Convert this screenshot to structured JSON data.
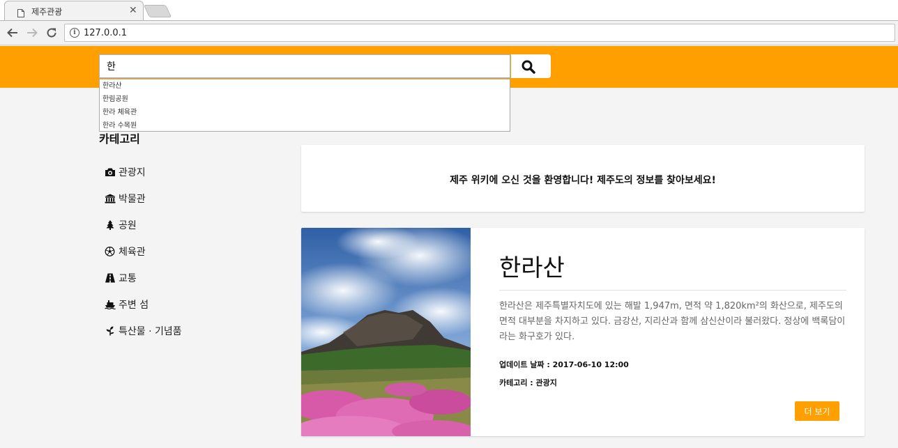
{
  "browser": {
    "tab_title": "제주관광",
    "close_glyph": "✕",
    "url": "127.0.0.1"
  },
  "search": {
    "value": "한",
    "icon": "search-icon"
  },
  "autocomplete": {
    "items": [
      "한라산",
      "한림공원",
      "한라 체육관",
      "한라 수목원"
    ]
  },
  "sidebar": {
    "title": "카테고리",
    "items": [
      {
        "label": "관광지",
        "icon": "camera-icon"
      },
      {
        "label": "박물관",
        "icon": "museum-icon"
      },
      {
        "label": "공원",
        "icon": "tree-icon"
      },
      {
        "label": "체육관",
        "icon": "soccer-ball-icon"
      },
      {
        "label": "교통",
        "icon": "road-icon"
      },
      {
        "label": "주변 섬",
        "icon": "ship-icon"
      },
      {
        "label": "특산물 · 기념품",
        "icon": "plant-icon"
      }
    ]
  },
  "welcome": {
    "text": "제주 위키에 오신 것을 환영합니다! 제주도의 정보를 찾아보세요!"
  },
  "feature": {
    "title": "한라산",
    "description": "한라산은 제주특별자치도에 있는 해발 1,947m, 면적 약 1,820km²의 화산으로, 제주도의 면적 대부분을 차지하고 있다. 금강산, 지리산과 함께 삼신산이라 불러왔다. 정상에 백록담이라는 화구호가 있다.",
    "updated": "업데이트 날짜 : 2017-06-10 12:00",
    "category": "카테고리 : 관광지",
    "more_label": "더 보기"
  },
  "colors": {
    "accent": "#ff9f00",
    "page_bg": "#f4f4f4"
  }
}
